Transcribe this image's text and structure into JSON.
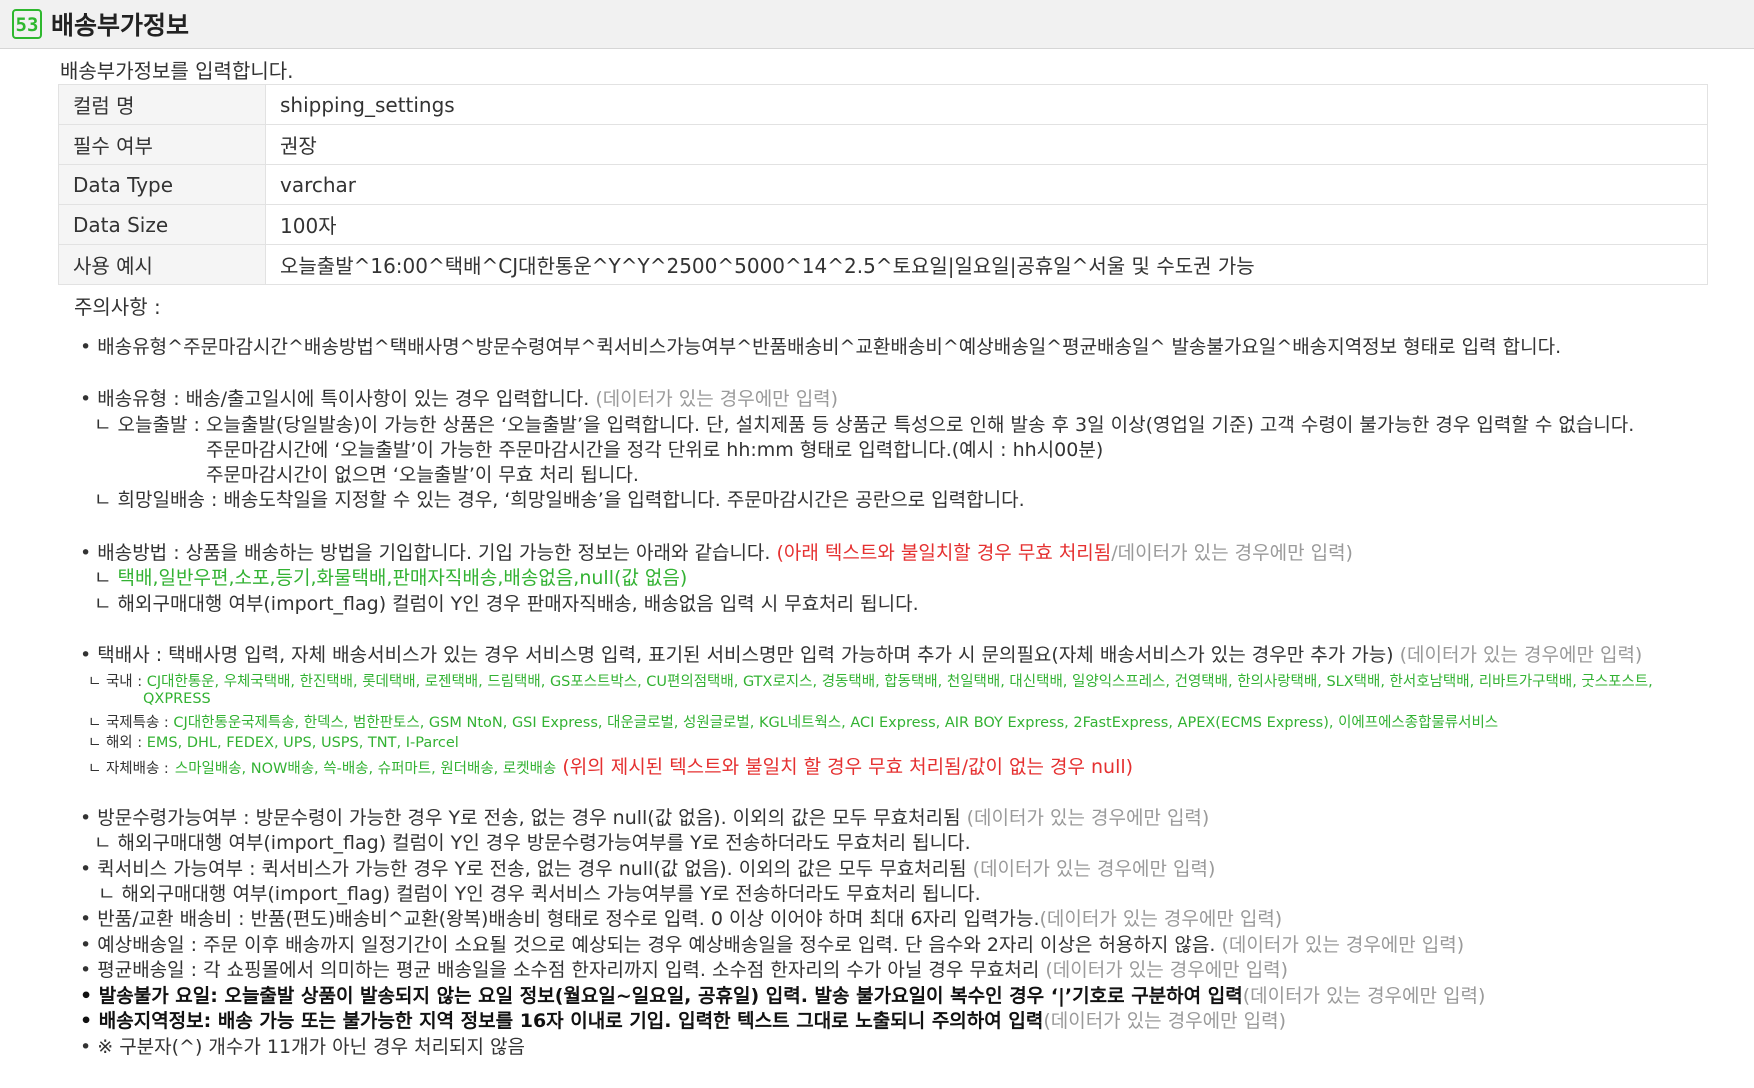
{
  "section": {
    "number": "53",
    "title": "배송부가정보"
  },
  "intro": "배송부가정보를 입력합니다.",
  "table": {
    "rows": [
      {
        "key": "컬럼 명",
        "value": "shipping_settings"
      },
      {
        "key": "필수 여부",
        "value": "권장"
      },
      {
        "key": "Data Type",
        "value": "varchar"
      },
      {
        "key": "Data Size",
        "value": "100자"
      },
      {
        "key": "사용 예시",
        "value": "오늘출발^16:00^택배^CJ대한통운^Y^Y^2500^5000^14^2.5^토요일|일요일|공휴일^서울 및 수도권 가능"
      }
    ]
  },
  "notes": {
    "heading": "주의사항 :",
    "format": "• 배송유형^주문마감시간^배송방법^택배사명^방문수령여부^퀵서비스가능여부^반품배송비^교환배송비^예상배송일^평균배송일^ 발송불가요일^배송지역정보 형태로 입력 합니다.",
    "data_only": "(데이터가 있는 경우에만 입력)",
    "type": {
      "main": "• 배송유형 : 배송/출고일시에 특이사항이 있는 경우 입력합니다.",
      "today_1": "ㄴ 오늘출발 : 오늘출발(당일발송)이 가능한 상품은 ‘오늘출발’을 입력합니다. 단, 설치제품 등 상품군 특성으로 인해 발송 후 3일 이상(영업일 기준) 고객 수령이 불가능한 경우 입력할 수 없습니다.",
      "today_2": "주문마감시간에 ‘오늘출발’이 가능한 주문마감시간을 정각 단위로 hh:mm 형태로 입력합니다.(예시 : hh시00분)",
      "today_3": "주문마감시간이 없으면 ‘오늘출발’이 무효 처리 됩니다.",
      "hope": "ㄴ 희망일배송 : 배송도착일을 지정할 수 있는 경우, ‘희망일배송’을 입력합니다. 주문마감시간은 공란으로 입력합니다."
    },
    "method": {
      "main": "• 배송방법 : 상품을 배송하는 방법을 기입합니다. 기입 가능한 정보는 아래와 같습니다.",
      "warn": "(아래 텍스트와 불일치할 경우 무효 처리됨",
      "warn_tail": "/데이터가 있는 경우에만 입력)",
      "prefix": "ㄴ",
      "options": "택배,일반우편,소포,등기,화물택배,판매자직배송,배송없음,null(값 없음)",
      "import": "ㄴ 해외구매대행 여부(import_flag) 컬럼이 Y인 경우 판매자직배송, 배송없음 입력 시 무효처리 됩니다."
    },
    "courier": {
      "main": "• 택배사 : 택배사명 입력, 자체 배송서비스가 있는 경우 서비스명 입력, 표기된 서비스명만 입력 가능하며 추가 시 문의필요(자체 배송서비스가 있는 경우만 추가 가능)",
      "domestic_label": "ㄴ 국내 :",
      "domestic_1": "CJ대한통운, 우체국택배, 한진택배, 롯데택배, 로젠택배, 드림택배, GS포스트박스, CU편의점택배, GTX로지스, 경동택배, 합동택배, 천일택배, 대신택배, 일양익스프레스, 건영택배, 한의사랑택배, SLX택배, 한서호남택배, 리바트가구택배, 굿스포스트,",
      "domestic_2": "QXPRESS",
      "intl_label": "ㄴ 국제특송 :",
      "intl": "CJ대한통운국제특송, 한덱스, 범한판토스, GSM NtoN, GSI Express, 대운글로벌, 성원글로벌, KGL네트웍스, ACI Express, AIR BOY Express, 2FastExpress, APEX(ECMS Express), 이에프에스종합물류서비스",
      "overseas_label": "ㄴ 해외 :",
      "overseas": "EMS, DHL, FEDEX, UPS, USPS, TNT, I-Parcel",
      "own_label": "ㄴ 자체배송 :",
      "own": "스마일배송, NOW배송, 쓱-배송, 슈퍼마트, 원더배송, 로켓배송",
      "own_warn": "(위의 제시된 텍스트와 불일치 할 경우 무효 처리됨/값이 없는 경우 null)"
    },
    "visit": {
      "main": "• 방문수령가능여부 : 방문수령이 가능한 경우 Y로 전송, 없는 경우 null(값 없음). 이외의 값은 모두 무효처리됨",
      "sub": "ㄴ 해외구매대행 여부(import_flag) 컬럼이 Y인 경우 방문수령가능여부를 Y로 전송하더라도 무효처리 됩니다."
    },
    "quick": {
      "main": "• 퀵서비스 가능여부 : 퀵서비스가 가능한 경우 Y로 전송, 없는 경우 null(값 없음). 이외의 값은 모두 무효처리됨",
      "sub": "ㄴ 해외구매대행 여부(import_flag) 컬럼이 Y인 경우 퀵서비스 가능여부를 Y로 전송하더라도 무효처리 됩니다."
    },
    "return_fee": "• 반품/교환 배송비 : 반품(편도)배송비^교환(왕복)배송비 형태로 정수로 입력. 0 이상 이어야 하며 최대 6자리 입력가능.",
    "expected": "• 예상배송일 : 주문 이후 배송까지 일정기간이 소요될 것으로 예상되는 경우 예상배송일을 정수로 입력. 단 음수와 2자리 이상은 허용하지 않음.",
    "average": "• 평균배송일 : 각 쇼핑몰에서 의미하는 평균 배송일을 소수점 한자리까지 입력. 소수점 한자리의 수가 아닐 경우 무효처리",
    "no_ship": "• 발송불가 요일: 오늘출발 상품이 발송되지 않는 요일 정보(월요일~일요일, 공휴일) 입력. 발송 불가요일이 복수인 경우 ‘|’기호로 구분하여 입력",
    "region": "• 배송지역정보: 배송 가능 또는 불가능한 지역 정보를 16자 이내로 기입. 입력한 텍스트 그대로 노출되니 주의하여 입력",
    "separator": "• ※ 구분자(^) 개수가 11개가 아닌 경우 처리되지 않음"
  }
}
